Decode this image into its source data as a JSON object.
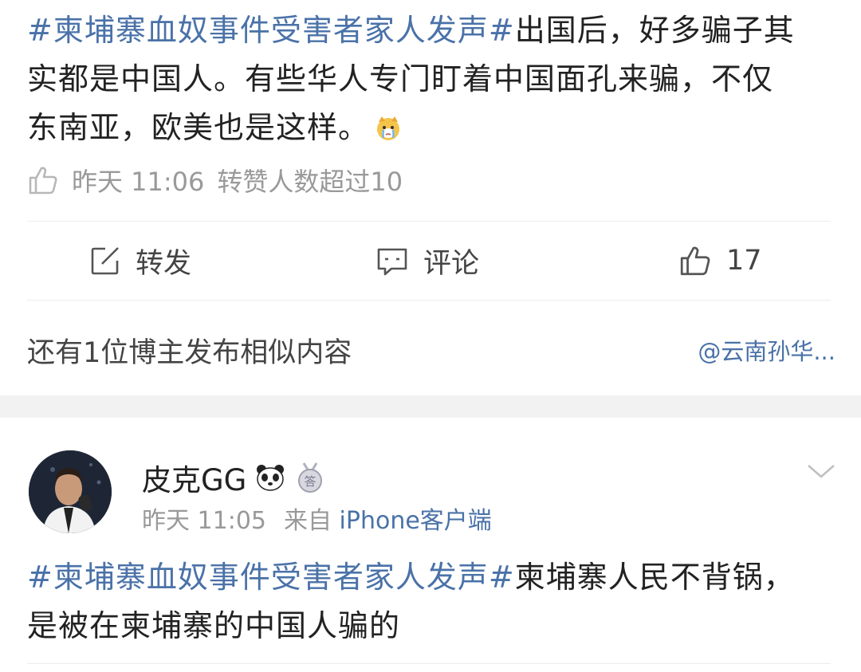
{
  "post1": {
    "hashtag": "#柬埔寨血奴事件受害者家人发声#",
    "text_line1_rest": "出国后，好多骗子其",
    "text_line2": "实都是中国人。有些华人专门盯着中国面孔来骗，不仅",
    "text_line3": "东南亚，欧美也是这样。",
    "emoji_icon": "crying-dog-emoji",
    "meta_time": "昨天 11:06",
    "meta_reposts": "转赞人数超过10"
  },
  "actions": {
    "repost_label": "转发",
    "comment_label": "评论",
    "like_count": "17"
  },
  "similar": {
    "text": "还有1位博主发布相似内容",
    "link": "@云南孙华..."
  },
  "post2": {
    "username": "皮克GG",
    "badge1_icon": "panda-icon",
    "badge2_icon": "answer-medal-icon",
    "time": "昨天 11:05",
    "source_prefix": "来自",
    "source": "iPhone客户端",
    "hashtag": "#柬埔寨血奴事件受害者家人发声#",
    "text_line1_rest": "柬埔寨人民不背锅，",
    "text_line2": "是被在柬埔寨的中国人骗的"
  },
  "colors": {
    "hashtag": "#4a72a8",
    "text": "#222222",
    "meta": "#999999",
    "band": "#f2f2f2"
  }
}
